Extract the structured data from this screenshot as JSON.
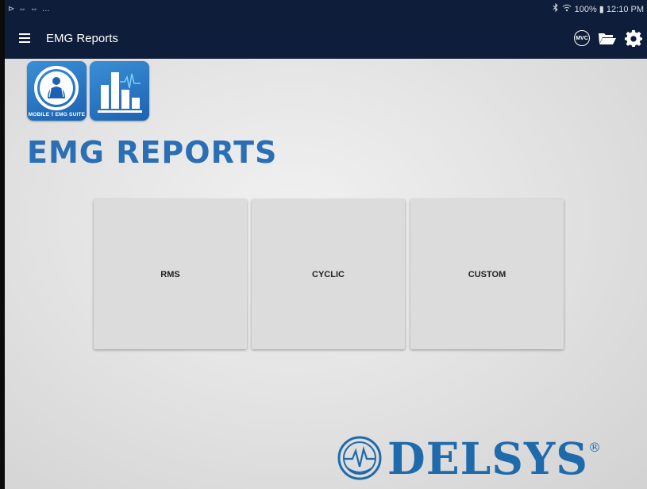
{
  "status_bar": {
    "left_text": "⊳ ⇔ ⇔ …",
    "right_text": "100% ▮ 12:10 PM",
    "bluetooth_icon": "bluetooth-icon",
    "wifi_icon": "wifi-icon"
  },
  "app_bar": {
    "title": "EMG Reports",
    "mvc_label": "MVC"
  },
  "logos": {
    "suite_text": "MOBILE ⌇ EMG SUITE"
  },
  "brand": {
    "title": "EMG REPORTS",
    "footer_word": "DELSYS",
    "footer_reg": "®"
  },
  "tiles": [
    {
      "label": "RMS"
    },
    {
      "label": "CYCLIC"
    },
    {
      "label": "CUSTOM"
    }
  ],
  "colors": {
    "app_bar": "#0e1e3a",
    "brand_blue": "#2a6fb5",
    "tile_bg": "#dcdcdc"
  }
}
